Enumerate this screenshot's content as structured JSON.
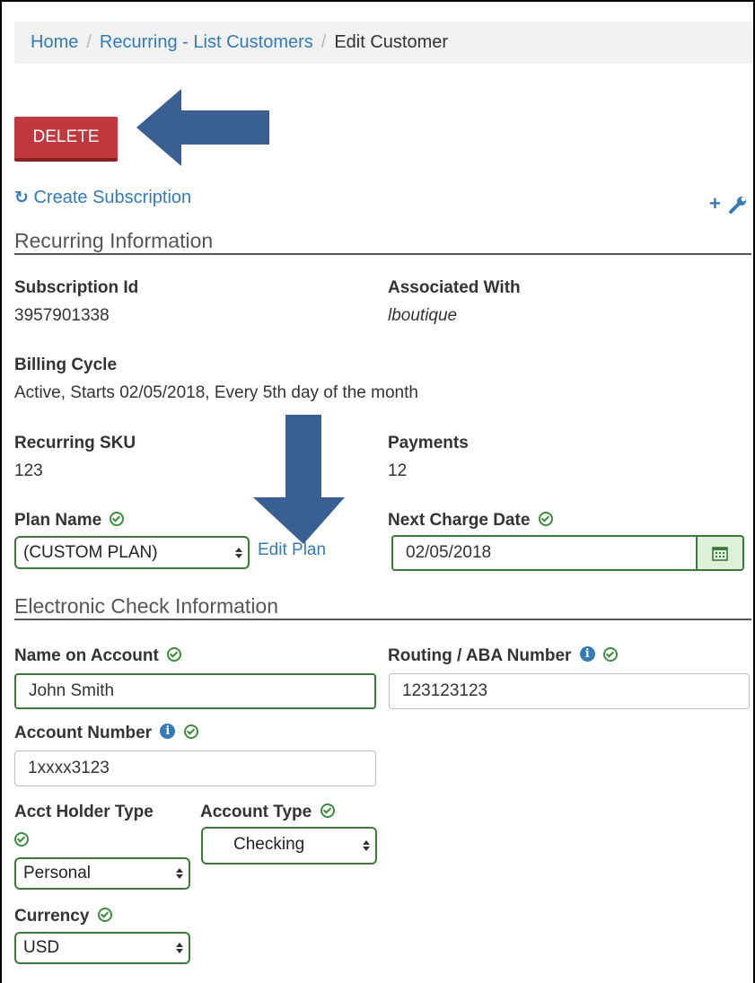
{
  "breadcrumb": {
    "home": "Home",
    "list": "Recurring - List Customers",
    "current": "Edit Customer",
    "sep": "/"
  },
  "actions": {
    "delete_label": "DELETE",
    "create_subscription": "Create Subscription"
  },
  "recurring": {
    "section_title": "Recurring Information",
    "subscription_id_label": "Subscription Id",
    "subscription_id": "3957901338",
    "associated_with_label": "Associated With",
    "associated_with": "lboutique",
    "billing_cycle_label": "Billing Cycle",
    "billing_cycle": "Active, Starts 02/05/2018, Every 5th day of the month",
    "sku_label": "Recurring SKU",
    "sku": "123",
    "payments_label": "Payments",
    "payments": "12",
    "plan_name_label": "Plan Name",
    "plan_name": "(CUSTOM PLAN)",
    "edit_plan": "Edit Plan",
    "next_charge_label": "Next Charge Date",
    "next_charge": "02/05/2018"
  },
  "check": {
    "section_title": "Electronic Check Information",
    "name_label": "Name on Account",
    "name": "John Smith",
    "routing_label": "Routing / ABA Number",
    "routing": "123123123",
    "account_number_label": "Account Number",
    "account_number": "1xxxx3123",
    "holder_type_label": "Acct Holder Type",
    "holder_type": "Personal",
    "account_type_label": "Account Type",
    "account_type": "Checking",
    "currency_label": "Currency",
    "currency": "USD"
  },
  "colors": {
    "link": "#337ab7",
    "delete": "#c1393e",
    "valid": "#3c8d3c",
    "annotation_arrow": "#3a5f92"
  }
}
